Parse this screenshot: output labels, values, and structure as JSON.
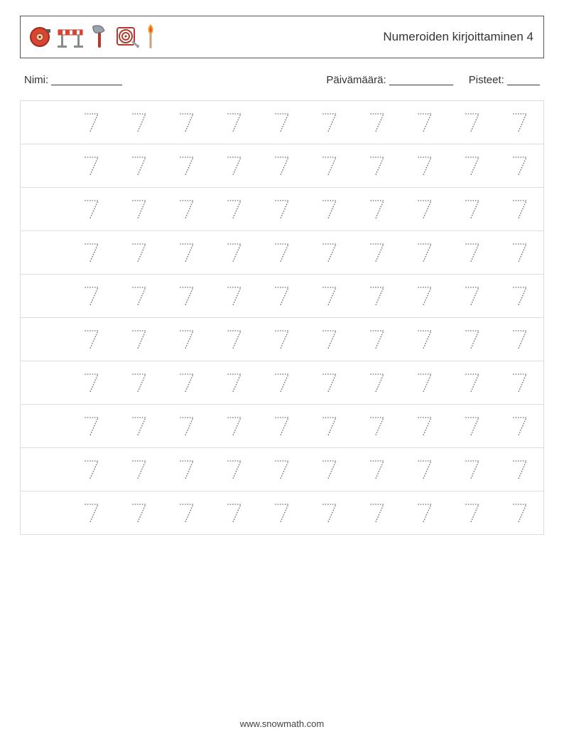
{
  "header": {
    "title": "Numeroiden kirjoittaminen 4",
    "icons": [
      "alarm-bell-icon",
      "roadblock-icon",
      "axe-icon",
      "fire-hose-icon",
      "match-icon"
    ]
  },
  "meta": {
    "name_label": "Nimi:",
    "date_label": "Päivämäärä:",
    "score_label": "Pisteet:"
  },
  "practice": {
    "digit": "7",
    "rows": 10,
    "first_column_blank": true,
    "columns_total": 11
  },
  "footer": {
    "url": "www.snowmath.com"
  }
}
